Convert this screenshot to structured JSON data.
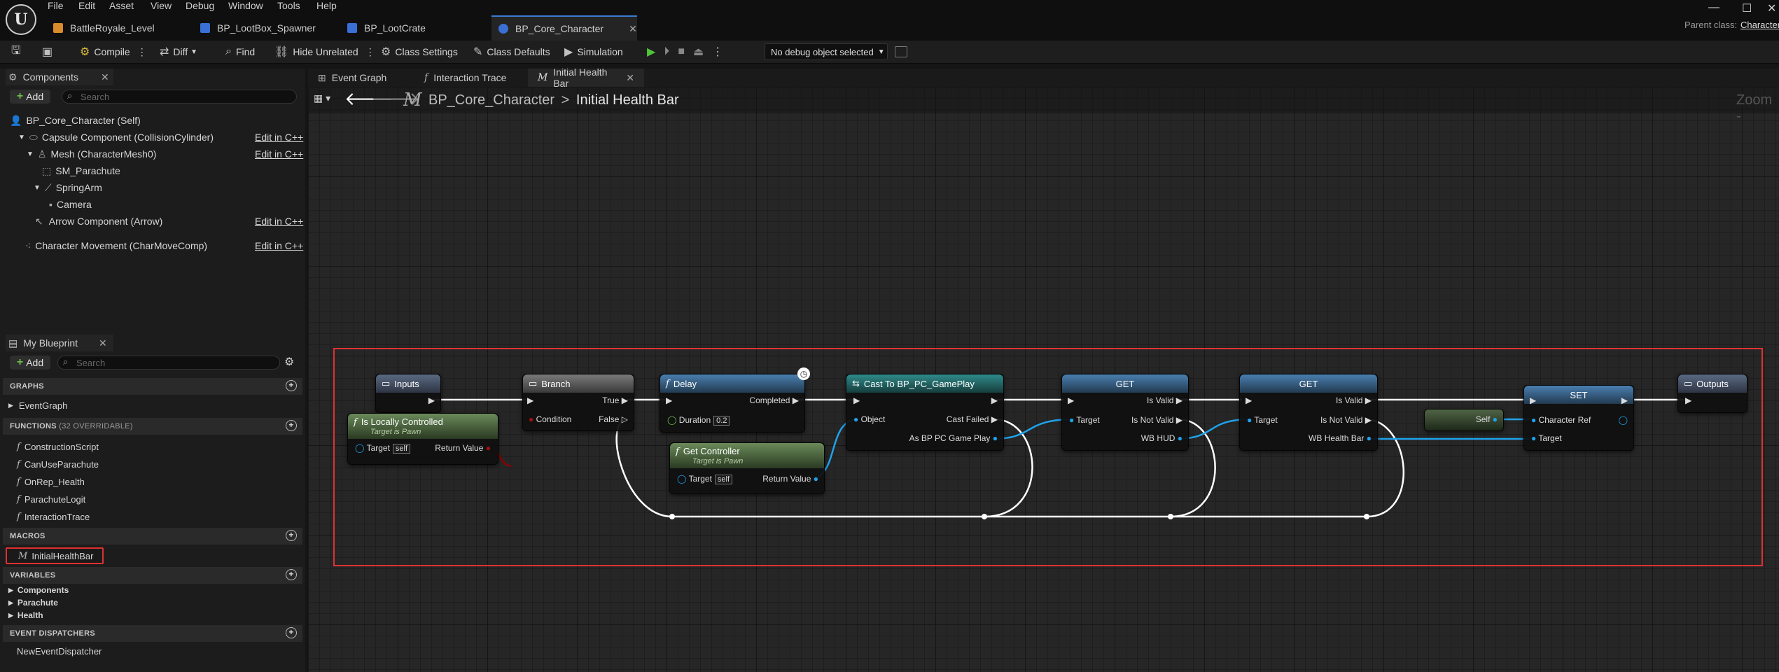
{
  "menu": [
    "File",
    "Edit",
    "Asset",
    "View",
    "Debug",
    "Window",
    "Tools",
    "Help"
  ],
  "doc_tabs": [
    "BattleRoyale_Level",
    "BP_LootBox_Spawner",
    "BP_LootCrate",
    "BP_Core_Character"
  ],
  "parent_class_label": "Parent class:",
  "parent_class_value": "Character",
  "toolbar": {
    "compile": "Compile",
    "diff": "Diff",
    "find": "Find",
    "hide_unrelated": "Hide Unrelated",
    "class_settings": "Class Settings",
    "class_defaults": "Class Defaults",
    "simulation": "Simulation",
    "debug_object": "No debug object selected"
  },
  "components": {
    "tab": "Components",
    "add": "Add",
    "search_placeholder": "Search",
    "items": [
      {
        "label": "BP_Core_Character (Self)",
        "edit": ""
      },
      {
        "label": "Capsule Component (CollisionCylinder)",
        "edit": "Edit in C++"
      },
      {
        "label": "Mesh (CharacterMesh0)",
        "edit": "Edit in C++"
      },
      {
        "label": "SM_Parachute",
        "edit": ""
      },
      {
        "label": "SpringArm",
        "edit": ""
      },
      {
        "label": "Camera",
        "edit": ""
      },
      {
        "label": "Arrow Component (Arrow)",
        "edit": "Edit in C++"
      },
      {
        "label": "Character Movement (CharMoveComp)",
        "edit": "Edit in C++"
      }
    ]
  },
  "my_blueprint": {
    "tab": "My Blueprint",
    "add": "Add",
    "search_placeholder": "Search",
    "graphs_header": "GRAPHS",
    "graphs": [
      "EventGraph"
    ],
    "functions_header": "FUNCTIONS",
    "functions_note": "(32 OVERRIDABLE)",
    "functions": [
      "ConstructionScript",
      "CanUseParachute",
      "OnRep_Health",
      "ParachuteLogit",
      "InteractionTrace"
    ],
    "macros_header": "MACROS",
    "macros": [
      "InitialHealthBar"
    ],
    "variables_header": "VARIABLES",
    "variables": [
      "Components",
      "Parachute",
      "Health"
    ],
    "dispatchers_header": "EVENT DISPATCHERS",
    "dispatchers": [
      "NewEventDispatcher"
    ]
  },
  "graph_tabs": [
    "Event Graph",
    "Interaction Trace",
    "Initial Health Bar"
  ],
  "breadcrumb": {
    "root": "BP_Core_Character",
    "sep": ">",
    "current": "Initial Health Bar"
  },
  "zoom_label": "Zoom -",
  "nodes": {
    "inputs": {
      "title": "Inputs"
    },
    "is_local": {
      "title": "Is Locally Controlled",
      "sub": "Target is Pawn",
      "target": "Target",
      "self": "self",
      "ret": "Return Value"
    },
    "branch": {
      "title": "Branch",
      "cond": "Condition",
      "true": "True",
      "false": "False"
    },
    "delay": {
      "title": "Delay",
      "duration": "Duration",
      "duration_val": "0.2",
      "completed": "Completed"
    },
    "get_controller": {
      "title": "Get Controller",
      "sub": "Target is Pawn",
      "target": "Target",
      "self": "self",
      "ret": "Return Value"
    },
    "cast": {
      "title": "Cast To BP_PC_GamePlay",
      "object": "Object",
      "cast_failed": "Cast Failed",
      "as": "As BP PC Game Play"
    },
    "get1": {
      "title": "GET",
      "is_valid": "Is Valid",
      "is_not_valid": "Is Not Valid",
      "target": "Target",
      "out": "WB HUD"
    },
    "get2": {
      "title": "GET",
      "is_valid": "Is Valid",
      "is_not_valid": "Is Not Valid",
      "target": "Target",
      "out": "WB Health Bar"
    },
    "self_node": {
      "label": "Self"
    },
    "set": {
      "title": "SET",
      "char_ref": "Character Ref",
      "target": "Target"
    },
    "outputs": {
      "title": "Outputs"
    }
  },
  "colors": {
    "accent": "#3a7bd5",
    "selection": "#e03030",
    "exec": "#ffffff",
    "object_pin": "#1fa3ec",
    "bool_pin": "#8c0000"
  }
}
